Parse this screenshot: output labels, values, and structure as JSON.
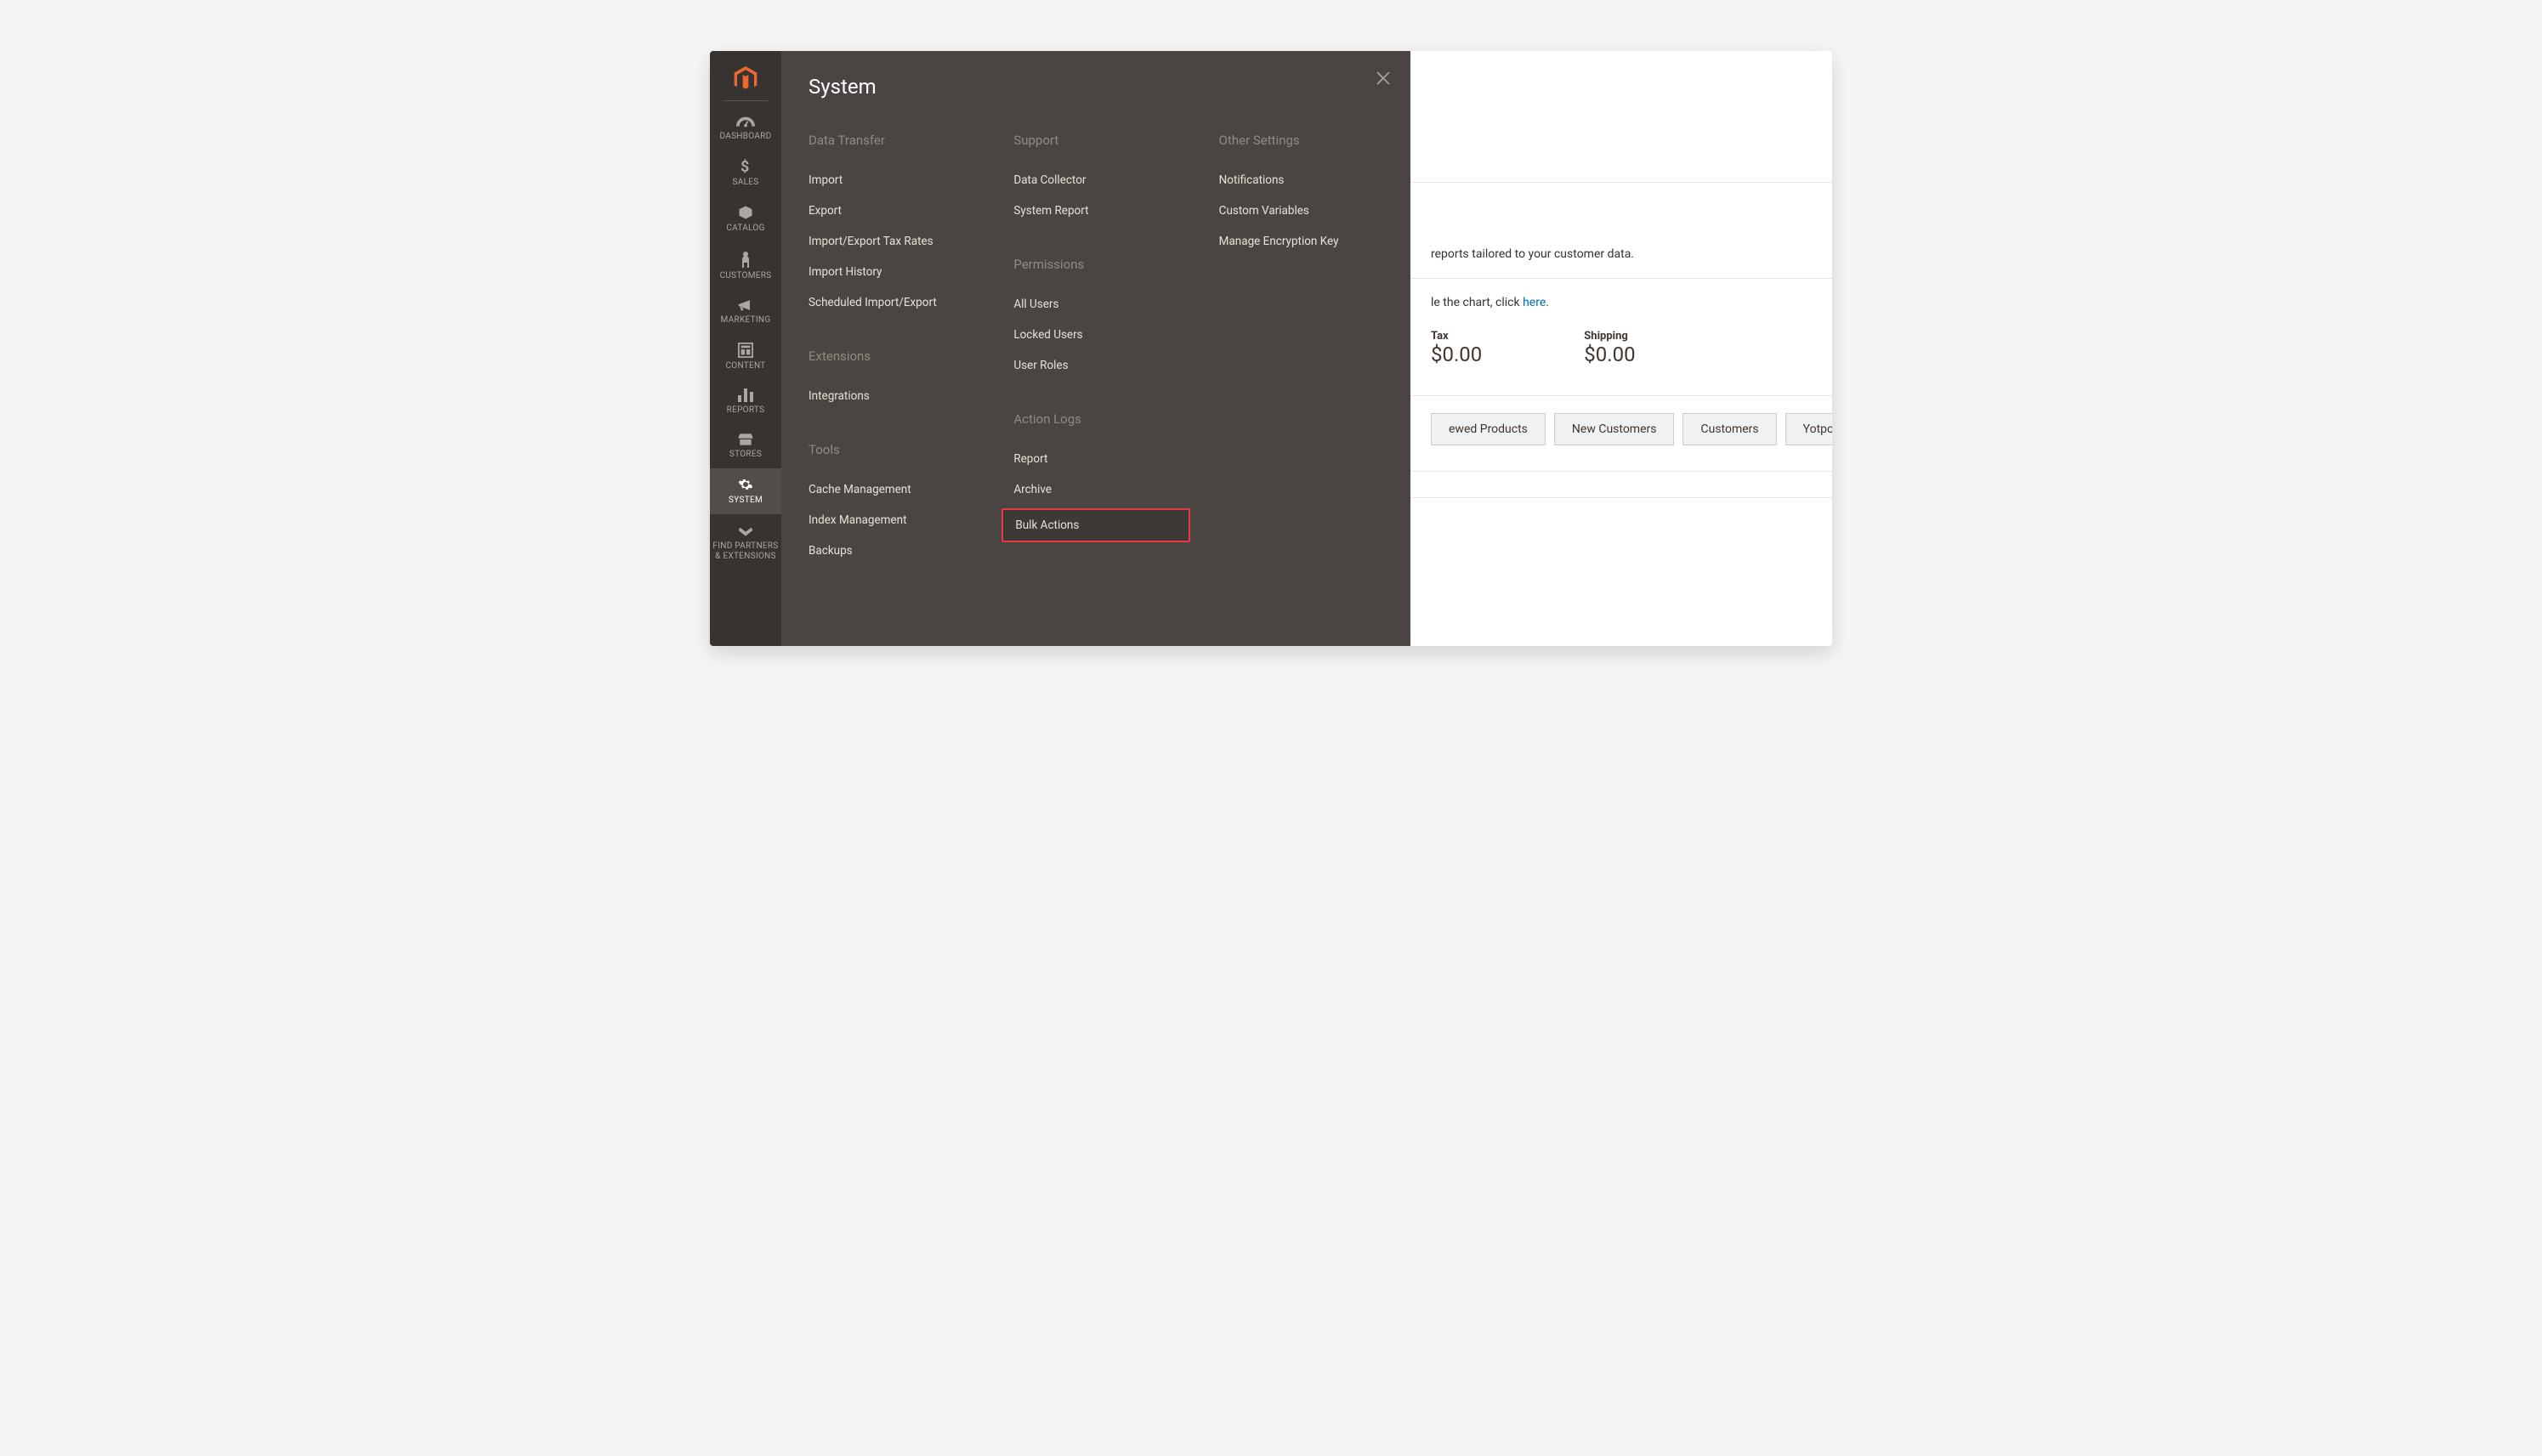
{
  "sidebar": {
    "items": [
      {
        "label": "DASHBOARD"
      },
      {
        "label": "SALES"
      },
      {
        "label": "CATALOG"
      },
      {
        "label": "CUSTOMERS"
      },
      {
        "label": "MARKETING"
      },
      {
        "label": "CONTENT"
      },
      {
        "label": "REPORTS"
      },
      {
        "label": "STORES"
      },
      {
        "label": "SYSTEM"
      },
      {
        "label": "FIND PARTNERS & EXTENSIONS"
      }
    ]
  },
  "mega": {
    "title": "System",
    "columns": [
      {
        "groups": [
          {
            "heading": "Data Transfer",
            "items": [
              "Import",
              "Export",
              "Import/Export Tax Rates",
              "Import History",
              "Scheduled Import/Export"
            ]
          },
          {
            "heading": "Extensions",
            "items": [
              "Integrations"
            ]
          },
          {
            "heading": "Tools",
            "items": [
              "Cache Management",
              "Index Management",
              "Backups"
            ]
          }
        ]
      },
      {
        "groups": [
          {
            "heading": "Support",
            "items": [
              "Data Collector",
              "System Report"
            ]
          },
          {
            "heading": "Permissions",
            "items": [
              "All Users",
              "Locked Users",
              "User Roles"
            ]
          },
          {
            "heading": "Action Logs",
            "items": [
              "Report",
              "Archive",
              "Bulk Actions"
            ]
          }
        ]
      },
      {
        "groups": [
          {
            "heading": "Other Settings",
            "items": [
              "Notifications",
              "Custom Variables",
              "Manage Encryption Key"
            ]
          }
        ]
      }
    ]
  },
  "content": {
    "reportsLine": "reports tailored to your customer data.",
    "chartLinePrefix": "le the chart, click ",
    "chartLineLink": "here",
    "chartLineSuffix": ".",
    "metrics": [
      {
        "label": "Tax",
        "value": "$0.00"
      },
      {
        "label": "Shipping",
        "value": "$0.00"
      }
    ],
    "tabs": [
      "ewed Products",
      "New Customers",
      "Customers",
      "Yotpo Reviews"
    ]
  }
}
